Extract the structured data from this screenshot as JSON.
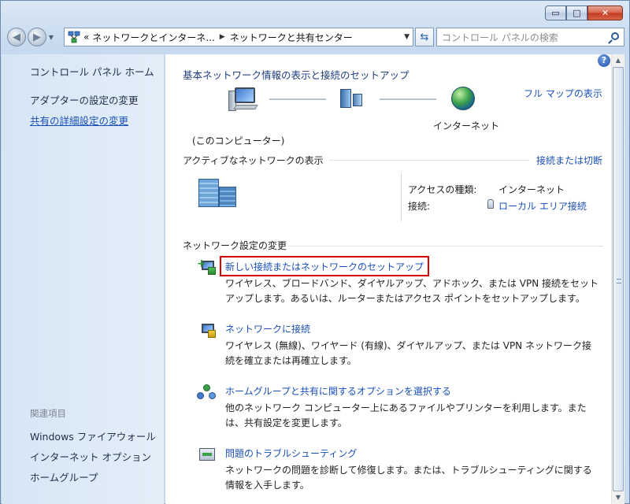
{
  "window": {
    "buttons": {
      "minimize": "▭",
      "maximize": "□",
      "close": "✕"
    }
  },
  "navigation": {
    "back": "◀",
    "forward": "▶",
    "address": {
      "overflow": "«",
      "crumb1": "ネットワークとインターネ...",
      "crumb2": "ネットワークと共有センター"
    },
    "search_placeholder": "コントロール パネルの検索"
  },
  "sidebar": {
    "home": "コントロール パネル ホーム",
    "adapter": "アダプターの設定の変更",
    "advanced": "共有の詳細設定の変更",
    "related_heading": "関連項目",
    "firewall": "Windows ファイアウォール",
    "internet_options": "インターネット オプション",
    "homegroup": "ホームグループ"
  },
  "main": {
    "title": "基本ネットワーク情報の表示と接続のセットアップ",
    "full_map": "フル マップの表示",
    "map_internet_label": "インターネット",
    "map_computer_label": "(このコンピューター)",
    "active_heading": "アクティブなネットワークの表示",
    "connect_disconnect": "接続または切断",
    "access_type_label": "アクセスの種類:",
    "access_type_value": "インターネット",
    "connection_label": "接続:",
    "connection_value": "ローカル エリア接続",
    "change_heading": "ネットワーク設定の変更",
    "options": [
      {
        "title": "新しい接続またはネットワークのセットアップ",
        "desc1": "ワイヤレス、ブロードバンド、ダイヤルアップ、アドホック、または VPN 接続をセット",
        "desc2": "アップします。あるいは、ルーターまたはアクセス ポイントをセットアップします。"
      },
      {
        "title": "ネットワークに接続",
        "desc1": "ワイヤレス (無線)、ワイヤード (有線)、ダイヤルアップ、または VPN ネットワーク接",
        "desc2": "続を確立または再確立します。"
      },
      {
        "title": "ホームグループと共有に関するオプションを選択する",
        "desc1": "他のネットワーク コンピューター上にあるファイルやプリンターを利用します。また",
        "desc2": "は、共有設定を変更します。"
      },
      {
        "title": "問題のトラブルシューティング",
        "desc1": "ネットワークの問題を診断して修復します。または、トラブルシューティングに関する",
        "desc2": "情報を入手します。"
      }
    ]
  },
  "colors": {
    "link": "#1a4fb8",
    "highlight": "#d90000"
  },
  "icons": [
    "network-center-icon",
    "computer-icon",
    "switch-icon",
    "globe-icon",
    "building-network-icon",
    "help-icon",
    "search-icon",
    "refresh-icon",
    "connection-icon"
  ]
}
